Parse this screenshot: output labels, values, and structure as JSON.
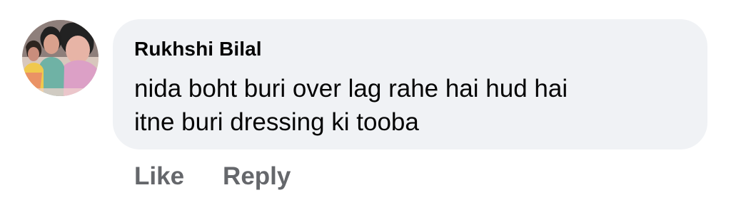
{
  "comment": {
    "author": "Rukhshi Bilal",
    "text_lines": [
      "nida boht buri over lag rahe hai hud hai",
      "itne buri dressing ki tooba"
    ],
    "actions": {
      "like_label": "Like",
      "reply_label": "Reply"
    },
    "avatar_icon": "profile-photo"
  },
  "colors": {
    "bubble_bg": "#f0f2f5",
    "text": "#050505",
    "action_text": "#65676b"
  }
}
